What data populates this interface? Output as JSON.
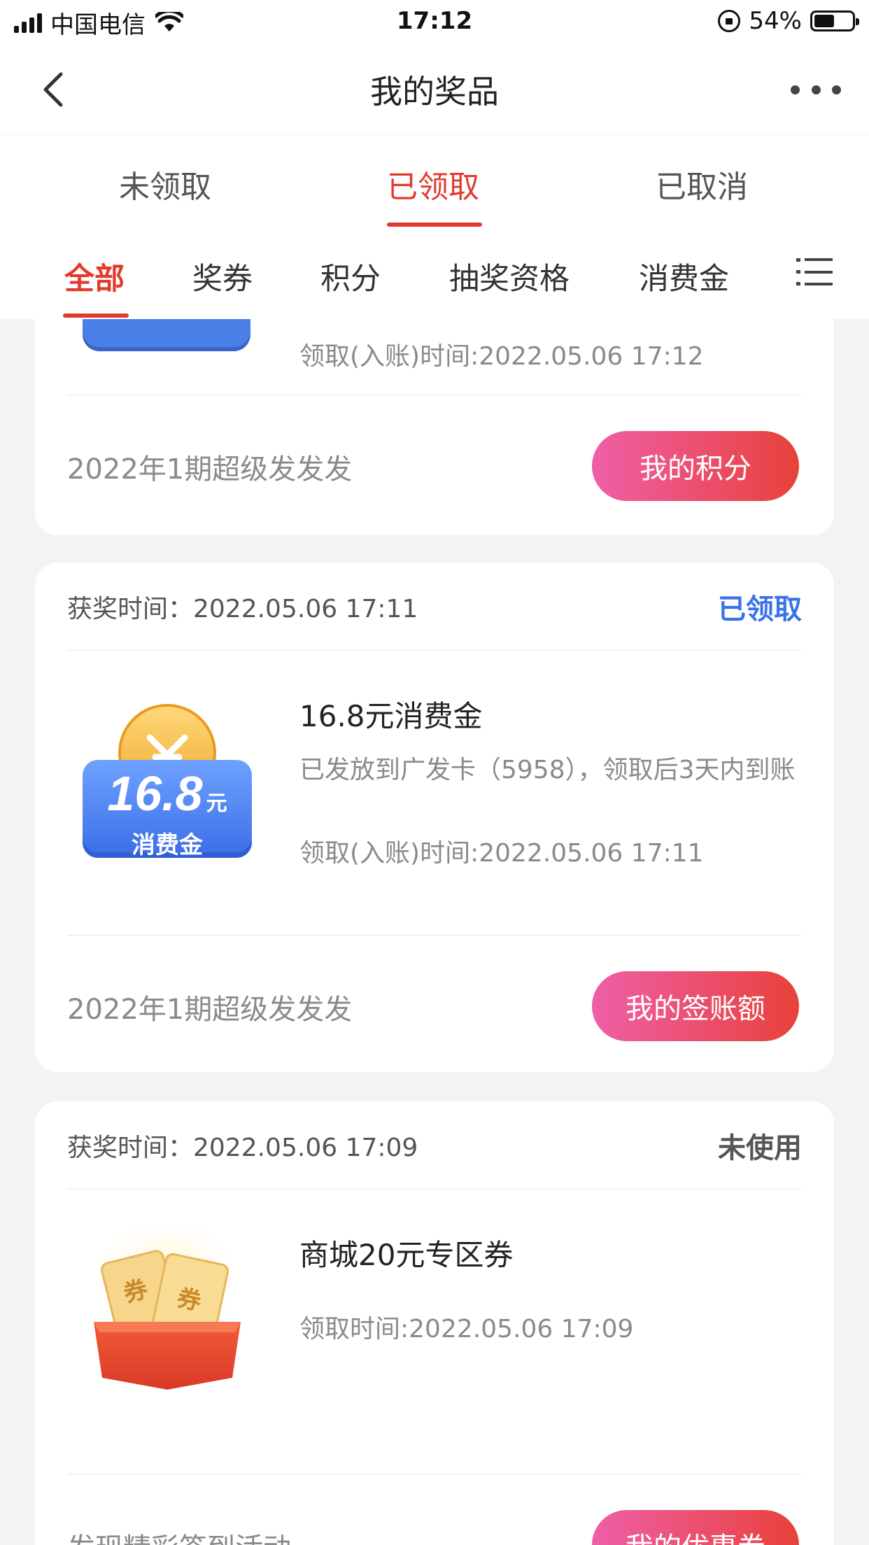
{
  "status_bar": {
    "carrier": "中国电信",
    "time": "17:12",
    "battery": "54%",
    "battery_level": 0.54
  },
  "nav": {
    "title": "我的奖品",
    "back_icon": "chevron-left-icon",
    "more_icon": "more-dots-icon"
  },
  "main_tabs": [
    {
      "label": "未领取",
      "active": false
    },
    {
      "label": "已领取",
      "active": true
    },
    {
      "label": "已取消",
      "active": false
    }
  ],
  "category_tabs": [
    {
      "label": "全部",
      "active": true
    },
    {
      "label": "奖券",
      "active": false
    },
    {
      "label": "积分",
      "active": false
    },
    {
      "label": "抽奖资格",
      "active": false
    },
    {
      "label": "消费金",
      "active": false
    }
  ],
  "category_menu_icon": "list-icon",
  "colors": {
    "accent": "#e23b2e",
    "claimed_blue": "#3a73e8",
    "button_gradient_start": "#ef5fa7",
    "button_gradient_end": "#e8413a"
  },
  "cards": [
    {
      "prize_time": "领取(入账)时间:2022.05.06 17:12",
      "activity": "2022年1期超级发发发",
      "button": "我的积分"
    },
    {
      "award_time": "获奖时间：2022.05.06 17:11",
      "status": "已领取",
      "prize_name": "16.8元消费金",
      "prize_desc": "已发放到广发卡（5958），领取后3天内到账",
      "prize_time": "领取(入账)时间:2022.05.06 17:11",
      "activity": "2022年1期超级发发发",
      "button": "我的签账额",
      "thumb": {
        "amount": "16.8",
        "unit": "元",
        "label": "消费金"
      }
    },
    {
      "award_time": "获奖时间：2022.05.06 17:09",
      "status": "未使用",
      "prize_name": "商城20元专区券",
      "prize_time": "领取时间:2022.05.06 17:09",
      "activity": "发现精彩签到活动",
      "button": "我的优惠券",
      "thumb": {
        "ticket_label": "券"
      }
    }
  ]
}
